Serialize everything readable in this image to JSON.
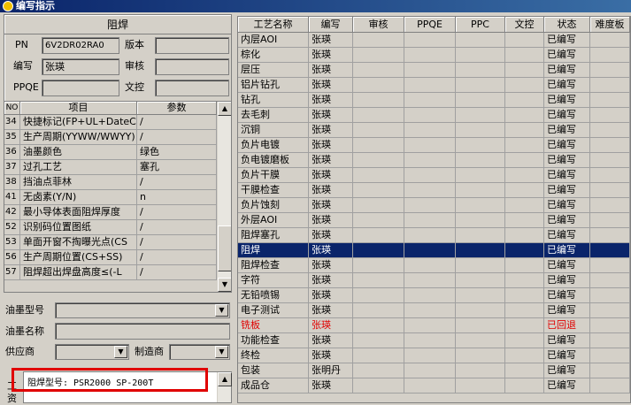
{
  "window": {
    "title": "编写指示"
  },
  "form": {
    "title": "阻焊",
    "pn_label": "PN",
    "pn_value": "6V2DR02RA0",
    "version_label": "版本",
    "version_value": "",
    "editor_label": "编写",
    "editor_value": "张瑛",
    "reviewer_label": "审核",
    "reviewer_value": "",
    "ppqe_label": "PPQE",
    "ppqe_value": "",
    "doc_control_label": "文控",
    "doc_control_value": ""
  },
  "params_table": {
    "headers": [
      "NO",
      "项目",
      "参数"
    ],
    "rows": [
      {
        "no": "34",
        "item": "快捷标记(FP+UL+DateCo",
        "value": "/"
      },
      {
        "no": "35",
        "item": "生产周期(YYWW/WWYY)",
        "value": "/"
      },
      {
        "no": "36",
        "item": "油墨颜色",
        "value": "绿色"
      },
      {
        "no": "37",
        "item": "过孔工艺",
        "value": "塞孔"
      },
      {
        "no": "38",
        "item": "挡油点菲林",
        "value": "/"
      },
      {
        "no": "41",
        "item": "无卤素(Y/N)",
        "value": "n"
      },
      {
        "no": "42",
        "item": "最小导体表面阻焊厚度",
        "value": "/"
      },
      {
        "no": "52",
        "item": "识别码位置图纸",
        "value": "/"
      },
      {
        "no": "53",
        "item": "单面开窗不掏曝光点(CS",
        "value": "/"
      },
      {
        "no": "56",
        "item": "生产周期位置(CS+SS)",
        "value": "/"
      },
      {
        "no": "57",
        "item": "阻焊超出焊盘高度≤(-L",
        "value": "/"
      }
    ]
  },
  "ink_model": {
    "label": "油墨型号",
    "value": ""
  },
  "ink_name": {
    "label": "油墨名称",
    "value": ""
  },
  "supplier": {
    "label": "供应商",
    "value": ""
  },
  "manufacturer": {
    "label": "制造商",
    "value": ""
  },
  "notes": {
    "side_label": "工 资",
    "text": "阻焊型号: PSR2000 SP-200T"
  },
  "process_table": {
    "headers": [
      "工艺名称",
      "编写",
      "审核",
      "PPQE",
      "PPC",
      "文控",
      "状态",
      "难度板"
    ],
    "rows": [
      {
        "name": "内层AOI",
        "editor": "张瑛",
        "status": "已编写"
      },
      {
        "name": "棕化",
        "editor": "张瑛",
        "status": "已编写"
      },
      {
        "name": "层压",
        "editor": "张瑛",
        "status": "已编写"
      },
      {
        "name": "铝片钻孔",
        "editor": "张瑛",
        "status": "已编写"
      },
      {
        "name": "钻孔",
        "editor": "张瑛",
        "status": "已编写"
      },
      {
        "name": "去毛刺",
        "editor": "张瑛",
        "status": "已编写"
      },
      {
        "name": "沉铜",
        "editor": "张瑛",
        "status": "已编写"
      },
      {
        "name": "负片电镀",
        "editor": "张瑛",
        "status": "已编写"
      },
      {
        "name": "负电镀磨板",
        "editor": "张瑛",
        "status": "已编写"
      },
      {
        "name": "负片干膜",
        "editor": "张瑛",
        "status": "已编写"
      },
      {
        "name": "干膜检查",
        "editor": "张瑛",
        "status": "已编写"
      },
      {
        "name": "负片蚀刻",
        "editor": "张瑛",
        "status": "已编写"
      },
      {
        "name": "外层AOI",
        "editor": "张瑛",
        "status": "已编写"
      },
      {
        "name": "阻焊塞孔",
        "editor": "张瑛",
        "status": "已编写"
      },
      {
        "name": "阻焊",
        "editor": "张瑛",
        "status": "已编写",
        "selected": true
      },
      {
        "name": "阻焊检查",
        "editor": "张瑛",
        "status": "已编写"
      },
      {
        "name": "字符",
        "editor": "张瑛",
        "status": "已编写"
      },
      {
        "name": "无铅喷锡",
        "editor": "张瑛",
        "status": "已编写"
      },
      {
        "name": "电子测试",
        "editor": "张瑛",
        "status": "已编写"
      },
      {
        "name": "铣板",
        "editor": "张瑛",
        "status": "已回退",
        "red": true
      },
      {
        "name": "功能检查",
        "editor": "张瑛",
        "status": "已编写"
      },
      {
        "name": "终检",
        "editor": "张瑛",
        "status": "已编写"
      },
      {
        "name": "包装",
        "editor": "张明丹",
        "status": "已编写"
      },
      {
        "name": "成品仓",
        "editor": "张瑛",
        "status": "已编写"
      }
    ]
  },
  "colors": {
    "selection": "#0a246a",
    "rollback": "#e00000",
    "highlight_box": "#e00000"
  }
}
